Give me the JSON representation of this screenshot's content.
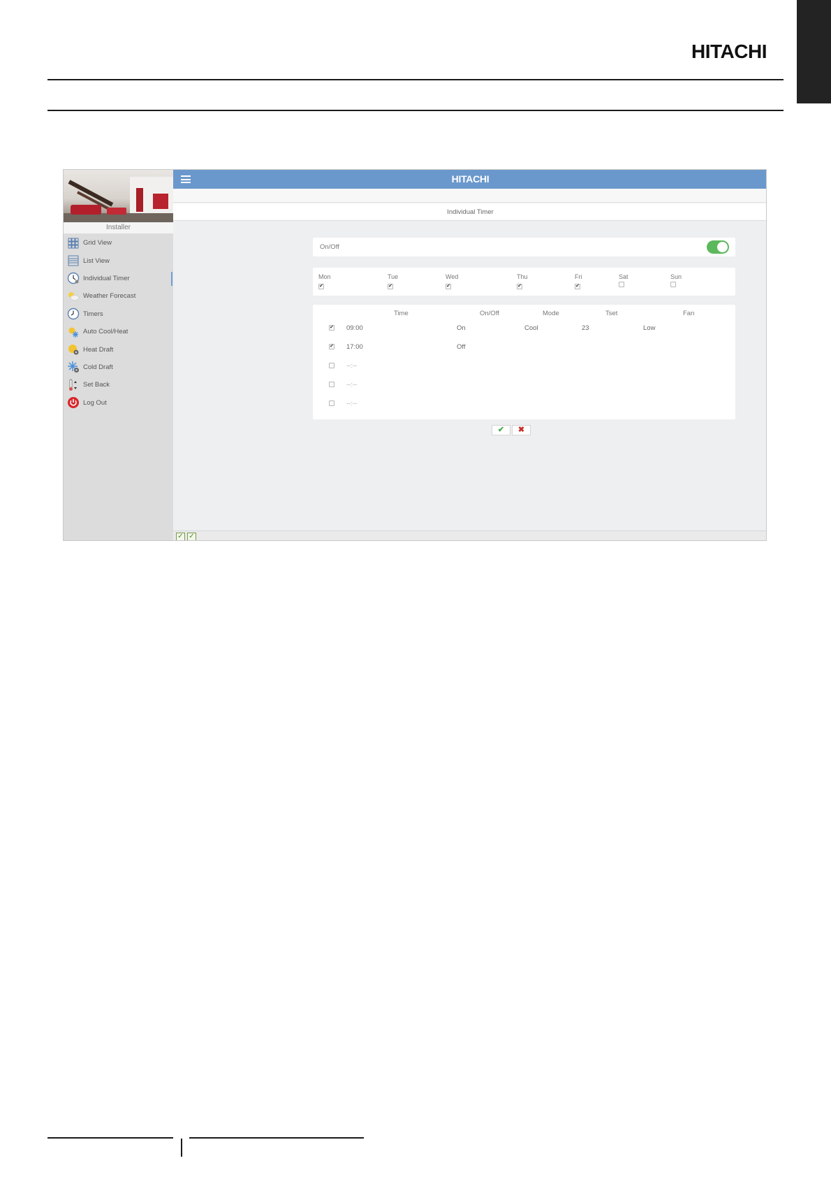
{
  "document": {
    "brand": "HITACHI"
  },
  "app": {
    "title": "HITACHI",
    "page_title": "Individual Timer",
    "sidebar": {
      "user_role": "Installer",
      "items": [
        {
          "label": "Grid View",
          "icon": "grid-icon"
        },
        {
          "label": "List View",
          "icon": "list-icon"
        },
        {
          "label": "Individual Timer",
          "icon": "clock-icon",
          "active": true
        },
        {
          "label": "Weather Forecast",
          "icon": "cloud-sun-icon"
        },
        {
          "label": "Timers",
          "icon": "clock-icon"
        },
        {
          "label": "Auto Cool/Heat",
          "icon": "sun-snowflake-icon"
        },
        {
          "label": "Heat Draft",
          "icon": "sun-fan-icon"
        },
        {
          "label": "Cold Draft",
          "icon": "snowflake-fan-icon"
        },
        {
          "label": "Set Back",
          "icon": "thermometer-icon"
        },
        {
          "label": "Log Out",
          "icon": "power-icon"
        }
      ]
    },
    "onoff": {
      "label": "On/Off",
      "enabled": true
    },
    "days": [
      {
        "label": "Mon",
        "checked": true
      },
      {
        "label": "Tue",
        "checked": true
      },
      {
        "label": "Wed",
        "checked": true
      },
      {
        "label": "Thu",
        "checked": true
      },
      {
        "label": "Fri",
        "checked": true
      },
      {
        "label": "Sat",
        "checked": false
      },
      {
        "label": "Sun",
        "checked": false
      }
    ],
    "schedule": {
      "columns": [
        "Time",
        "On/Off",
        "Mode",
        "Tset",
        "Fan"
      ],
      "rows": [
        {
          "checked": true,
          "time": "09:00",
          "onoff": "On",
          "mode": "Cool",
          "tset": "23",
          "fan": "Low"
        },
        {
          "checked": true,
          "time": "17:00",
          "onoff": "Off",
          "mode": "",
          "tset": "",
          "fan": ""
        },
        {
          "checked": false,
          "time": "--:--",
          "onoff": "",
          "mode": "",
          "tset": "",
          "fan": ""
        },
        {
          "checked": false,
          "time": "--:--",
          "onoff": "",
          "mode": "",
          "tset": "",
          "fan": ""
        },
        {
          "checked": false,
          "time": "--:--",
          "onoff": "",
          "mode": "",
          "tset": "",
          "fan": ""
        }
      ]
    },
    "actions": {
      "confirm": "✔",
      "cancel": "✖"
    },
    "statusbar": {
      "check1": "✓",
      "check2": "✓"
    },
    "colors": {
      "topbar": "#6b98cc",
      "toggle_on": "#5cb85c",
      "confirm": "#4aa84a",
      "cancel": "#c9302c"
    }
  }
}
